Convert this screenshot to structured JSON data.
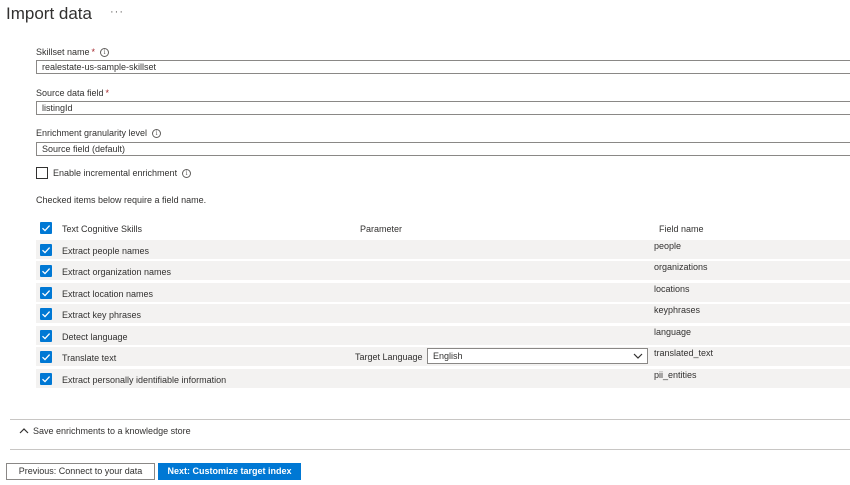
{
  "page": {
    "title": "Import data",
    "more_label": "···"
  },
  "form": {
    "skillset_name_label": "Skillset name",
    "required_marker": "*",
    "skillset_name_value": "realestate-us-sample-skillset",
    "source_field_label": "Source data field",
    "source_field_value": "listingId",
    "granularity_label": "Enrichment granularity level",
    "granularity_value": "Source field (default)",
    "incremental_label": "Enable incremental enrichment",
    "note": "Checked items below require a field name."
  },
  "grid": {
    "header": {
      "skills": "Text Cognitive Skills",
      "parameter": "Parameter",
      "field_name": "Field name"
    },
    "rows": [
      {
        "skill": "Extract people names",
        "field": "people"
      },
      {
        "skill": "Extract organization names",
        "field": "organizations"
      },
      {
        "skill": "Extract location names",
        "field": "locations"
      },
      {
        "skill": "Extract key phrases",
        "field": "keyphrases"
      },
      {
        "skill": "Detect language",
        "field": "language"
      },
      {
        "skill": "Translate text",
        "field": "translated_text",
        "param_label": "Target Language",
        "param_value": "English"
      },
      {
        "skill": "Extract personally identifiable information",
        "field": "pii_entities"
      }
    ]
  },
  "knowledge_store": {
    "label": "Save enrichments to a knowledge store"
  },
  "footer": {
    "previous_label": "Previous: Connect to your data",
    "next_label": "Next: Customize target index"
  },
  "colors": {
    "accent": "#0078d4",
    "required": "#a4262c"
  }
}
